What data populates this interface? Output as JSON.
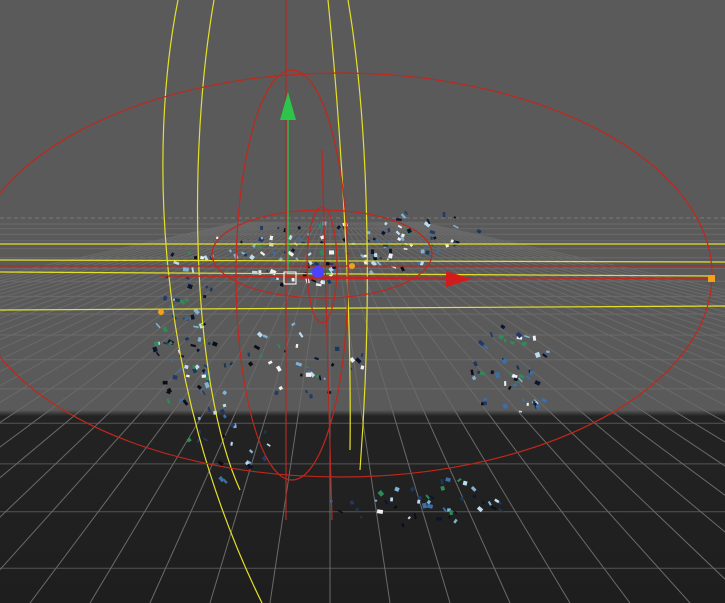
{
  "viewport": {
    "view": "perspective-3d-viewport",
    "background_upper": "#5a5a5a",
    "background_lower": "#232323",
    "grid_color": "#6a6a6a",
    "grid_color_floor": "#555555",
    "horizon_dashed_color": "#7a7a7a"
  },
  "gizmo": {
    "ring_color": "#c0271c",
    "y_axis_color": "#2ec44a",
    "x_axis_color": "#d21c1c",
    "axis_line_color": "#b22a22",
    "center_handle_color": "#4b43ff",
    "handle_color": "#f2a21a"
  },
  "bounding_guides": {
    "color": "#e4e02a"
  },
  "particles": {
    "colors": [
      "#0c1530",
      "#223a6a",
      "#3a6fa8",
      "#7fb2d6",
      "#bfdcef",
      "#f0f0f0",
      "#19395a",
      "#2f8a57",
      "#0d0d1a"
    ]
  }
}
